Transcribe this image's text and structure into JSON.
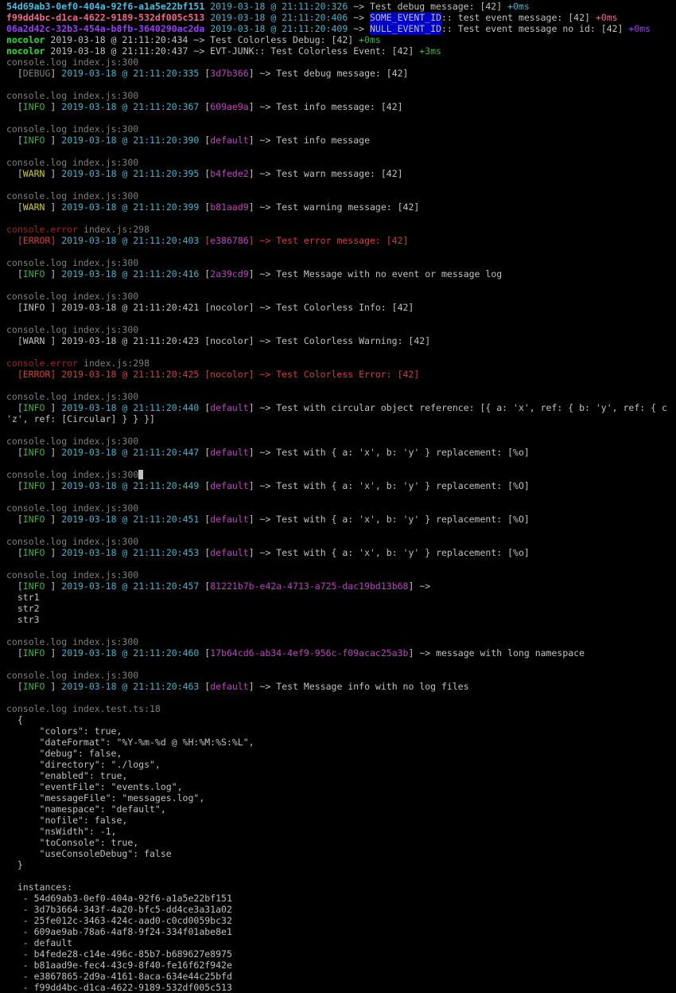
{
  "colors": {
    "default": "#c0c0c0",
    "gray": "#7f7f7f",
    "cyan": "#3ab7cd",
    "cyan_bright": "#3fc1e6",
    "green": "#3fb23f",
    "green_bright": "#22e022",
    "magenta": "#c040c0",
    "pink": "#f06892",
    "red": "#d63c3c",
    "darkred": "#a02222",
    "yellow": "#d2d200",
    "purple": "#9b3df5",
    "blue_bg": "#0000c8"
  },
  "lines": [
    [
      {
        "t": "54d69ab3-0ef0-404a-92f6-a1a5e22bf151",
        "c": "cyan_bright",
        "b": true
      },
      {
        "t": " "
      },
      {
        "t": "2019-03-18 @ 21:11:20:326",
        "c": "cyan"
      },
      {
        "t": " ~> Test debug message: [42] "
      },
      {
        "t": "+0ms",
        "c": "cyan"
      }
    ],
    [
      {
        "t": "f99dd4bc-d1ca-4622-9189-532df005c513",
        "c": "pink",
        "b": true
      },
      {
        "t": " "
      },
      {
        "t": "2019-03-18 @ 21:11:20:406",
        "c": "cyan"
      },
      {
        "t": " ~> "
      },
      {
        "t": "SOME_EVENT_ID",
        "bg": "blue_bg"
      },
      {
        "t": ":: test event message: [42] "
      },
      {
        "t": "+0ms",
        "c": "pink"
      }
    ],
    [
      {
        "t": "06a2d42c-32b3-454a-b8fb-3640290ac2da",
        "c": "purple",
        "b": true
      },
      {
        "t": " "
      },
      {
        "t": "2019-03-18 @ 21:11:20:409",
        "c": "cyan"
      },
      {
        "t": " ~> "
      },
      {
        "t": "NULL_EVENT_ID",
        "bg": "blue_bg"
      },
      {
        "t": ":: Test event message no id: [42] "
      },
      {
        "t": "+0ms",
        "c": "purple"
      }
    ],
    [
      {
        "t": "nocolor",
        "c": "green_bright",
        "b": true
      },
      {
        "t": " 2019-03-18 @ 21:11:20:434 ~> Test Colorless Debug: [42] "
      },
      {
        "t": "+0ms",
        "c": "green"
      }
    ],
    [
      {
        "t": "nocolor",
        "c": "green_bright",
        "b": true
      },
      {
        "t": " 2019-03-18 @ 21:11:20:437 ~> EVT-JUNK:: Test Colorless Event: [42] "
      },
      {
        "t": "+3ms",
        "c": "green"
      }
    ],
    [
      {
        "t": "console.log index.js:300",
        "c": "gray"
      }
    ],
    [
      {
        "t": "  ["
      },
      {
        "t": "DEBUG",
        "c": "gray"
      },
      {
        "t": "] "
      },
      {
        "t": "2019-03-18 @ 21:11:20:335",
        "c": "cyan"
      },
      {
        "t": " ["
      },
      {
        "t": "3d7b366",
        "c": "magenta"
      },
      {
        "t": "] ~> Test debug message: [42]"
      }
    ],
    [],
    [
      {
        "t": "console.log index.js:300",
        "c": "gray"
      }
    ],
    [
      {
        "t": "  ["
      },
      {
        "t": "INFO",
        "c": "green"
      },
      {
        "t": " ] "
      },
      {
        "t": "2019-03-18 @ 21:11:20:367",
        "c": "cyan"
      },
      {
        "t": " ["
      },
      {
        "t": "609ae9a",
        "c": "magenta"
      },
      {
        "t": "] ~> Test info message: [42]"
      }
    ],
    [],
    [
      {
        "t": "console.log index.js:300",
        "c": "gray"
      }
    ],
    [
      {
        "t": "  ["
      },
      {
        "t": "INFO",
        "c": "green"
      },
      {
        "t": " ] "
      },
      {
        "t": "2019-03-18 @ 21:11:20:390",
        "c": "cyan"
      },
      {
        "t": " ["
      },
      {
        "t": "default",
        "c": "magenta"
      },
      {
        "t": "] ~> Test info message"
      }
    ],
    [],
    [
      {
        "t": "console.log index.js:300",
        "c": "gray"
      }
    ],
    [
      {
        "t": "  ["
      },
      {
        "t": "WARN",
        "c": "yellow"
      },
      {
        "t": " ] "
      },
      {
        "t": "2019-03-18 @ 21:11:20:395",
        "c": "cyan"
      },
      {
        "t": " ["
      },
      {
        "t": "b4fede2",
        "c": "magenta"
      },
      {
        "t": "] ~> Test warn message: [42]"
      }
    ],
    [],
    [
      {
        "t": "console.log index.js:300",
        "c": "gray"
      }
    ],
    [
      {
        "t": "  ["
      },
      {
        "t": "WARN",
        "c": "yellow"
      },
      {
        "t": " ] "
      },
      {
        "t": "2019-03-18 @ 21:11:20:399",
        "c": "cyan"
      },
      {
        "t": " ["
      },
      {
        "t": "b81aad9",
        "c": "magenta"
      },
      {
        "t": "] ~> Test warning message: [42]"
      }
    ],
    [],
    [
      {
        "t": "console.error",
        "c": "darkred"
      },
      {
        "t": " index.js:298",
        "c": "gray"
      }
    ],
    [
      {
        "t": "  [ERROR] ",
        "c": "red"
      },
      {
        "t": "2019-03-18 @ 21:11:20:403",
        "c": "cyan"
      },
      {
        "t": " [",
        "c": "red"
      },
      {
        "t": "e386786",
        "c": "magenta"
      },
      {
        "t": "] ~> Test error message: [42]",
        "c": "red"
      }
    ],
    [],
    [
      {
        "t": "console.log index.js:300",
        "c": "gray"
      }
    ],
    [
      {
        "t": "  ["
      },
      {
        "t": "INFO",
        "c": "green"
      },
      {
        "t": " ] "
      },
      {
        "t": "2019-03-18 @ 21:11:20:416",
        "c": "cyan"
      },
      {
        "t": " ["
      },
      {
        "t": "2a39cd9",
        "c": "magenta"
      },
      {
        "t": "] ~> Test Message with no event or message log"
      }
    ],
    [],
    [
      {
        "t": "console.log index.js:300",
        "c": "gray"
      }
    ],
    [
      {
        "t": "  [INFO ] 2019-03-18 @ 21:11:20:421 [nocolor] ~> Test Colorless Info: [42]"
      }
    ],
    [],
    [
      {
        "t": "console.log index.js:300",
        "c": "gray"
      }
    ],
    [
      {
        "t": "  [WARN ] 2019-03-18 @ 21:11:20:423 [nocolor] ~> Test Colorless Warning: [42]"
      }
    ],
    [],
    [
      {
        "t": "console.error",
        "c": "darkred"
      },
      {
        "t": " index.js:298",
        "c": "gray"
      }
    ],
    [
      {
        "t": "  [ERROR] 2019-03-18 @ 21:11:20:425 [nocolor] ~> Test Colorless Error: [42]",
        "c": "red"
      }
    ],
    [],
    [
      {
        "t": "console.log index.js:300",
        "c": "gray"
      }
    ],
    [
      {
        "t": "  ["
      },
      {
        "t": "INFO",
        "c": "green"
      },
      {
        "t": " ] "
      },
      {
        "t": "2019-03-18 @ 21:11:20:440",
        "c": "cyan"
      },
      {
        "t": " ["
      },
      {
        "t": "default",
        "c": "magenta"
      },
      {
        "t": "] ~> Test with circular object reference: [{ a: 'x', ref: { b: 'y', ref: { c"
      }
    ],
    [
      {
        "t": "'z', ref: [Circular] } } }]"
      }
    ],
    [],
    [
      {
        "t": "console.log index.js:300",
        "c": "gray"
      }
    ],
    [
      {
        "t": "  ["
      },
      {
        "t": "INFO",
        "c": "green"
      },
      {
        "t": " ] "
      },
      {
        "t": "2019-03-18 @ 21:11:20:447",
        "c": "cyan"
      },
      {
        "t": " ["
      },
      {
        "t": "default",
        "c": "magenta"
      },
      {
        "t": "] ~> Test with { a: 'x', b: 'y' } replacement: [%o]"
      }
    ],
    [],
    [
      {
        "t": "console.log index.js:300",
        "c": "gray"
      },
      {
        "cursor": true
      }
    ],
    [
      {
        "t": "  ["
      },
      {
        "t": "INFO",
        "c": "green"
      },
      {
        "t": " ] "
      },
      {
        "t": "2019-03-18 @ 21:11:20:449",
        "c": "cyan"
      },
      {
        "t": " ["
      },
      {
        "t": "default",
        "c": "magenta"
      },
      {
        "t": "] ~> Test with { a: 'x', b: 'y' } replacement: [%O]"
      }
    ],
    [],
    [
      {
        "t": "console.log index.js:300",
        "c": "gray"
      }
    ],
    [
      {
        "t": "  ["
      },
      {
        "t": "INFO",
        "c": "green"
      },
      {
        "t": " ] "
      },
      {
        "t": "2019-03-18 @ 21:11:20:451",
        "c": "cyan"
      },
      {
        "t": " ["
      },
      {
        "t": "default",
        "c": "magenta"
      },
      {
        "t": "] ~> Test with { a: 'x', b: 'y' } replacement: [%O]"
      }
    ],
    [],
    [
      {
        "t": "console.log index.js:300",
        "c": "gray"
      }
    ],
    [
      {
        "t": "  ["
      },
      {
        "t": "INFO",
        "c": "green"
      },
      {
        "t": " ] "
      },
      {
        "t": "2019-03-18 @ 21:11:20:453",
        "c": "cyan"
      },
      {
        "t": " ["
      },
      {
        "t": "default",
        "c": "magenta"
      },
      {
        "t": "] ~> Test with { a: 'x', b: 'y' } replacement: [%o]"
      }
    ],
    [],
    [
      {
        "t": "console.log index.js:300",
        "c": "gray"
      }
    ],
    [
      {
        "t": "  ["
      },
      {
        "t": "INFO",
        "c": "green"
      },
      {
        "t": " ] "
      },
      {
        "t": "2019-03-18 @ 21:11:20:457",
        "c": "cyan"
      },
      {
        "t": " ["
      },
      {
        "t": "81221b7b-e42a-4713-a725-dac19bd13b68",
        "c": "magenta"
      },
      {
        "t": "] ~>"
      }
    ],
    [
      {
        "t": "  str1"
      }
    ],
    [
      {
        "t": "  str2"
      }
    ],
    [
      {
        "t": "  str3"
      }
    ],
    [],
    [
      {
        "t": "console.log index.js:300",
        "c": "gray"
      }
    ],
    [
      {
        "t": "  ["
      },
      {
        "t": "INFO",
        "c": "green"
      },
      {
        "t": " ] "
      },
      {
        "t": "2019-03-18 @ 21:11:20:460",
        "c": "cyan"
      },
      {
        "t": " ["
      },
      {
        "t": "17b64cd6-ab34-4ef9-956c-f09acac25a3b",
        "c": "magenta"
      },
      {
        "t": "] ~> message with long namespace"
      }
    ],
    [],
    [
      {
        "t": "console.log index.js:300",
        "c": "gray"
      }
    ],
    [
      {
        "t": "  ["
      },
      {
        "t": "INFO",
        "c": "green"
      },
      {
        "t": " ] "
      },
      {
        "t": "2019-03-18 @ 21:11:20:463",
        "c": "cyan"
      },
      {
        "t": " ["
      },
      {
        "t": "default",
        "c": "magenta"
      },
      {
        "t": "] ~> Test Message info with no log files"
      }
    ],
    [],
    [
      {
        "t": "console.log index.test.ts:18",
        "c": "gray"
      }
    ],
    [
      {
        "t": "  {"
      }
    ],
    [
      {
        "t": "      \"colors\": true,"
      }
    ],
    [
      {
        "t": "      \"dateFormat\": \"%Y-%m-%d @ %H:%M:%S:%L\","
      }
    ],
    [
      {
        "t": "      \"debug\": false,"
      }
    ],
    [
      {
        "t": "      \"directory\": \"./logs\","
      }
    ],
    [
      {
        "t": "      \"enabled\": true,"
      }
    ],
    [
      {
        "t": "      \"eventFile\": \"events.log\","
      }
    ],
    [
      {
        "t": "      \"messageFile\": \"messages.log\","
      }
    ],
    [
      {
        "t": "      \"namespace\": \"default\","
      }
    ],
    [
      {
        "t": "      \"nofile\": false,"
      }
    ],
    [
      {
        "t": "      \"nsWidth\": -1,"
      }
    ],
    [
      {
        "t": "      \"toConsole\": true,"
      }
    ],
    [
      {
        "t": "      \"useConsoleDebug\": false"
      }
    ],
    [
      {
        "t": "  }"
      }
    ],
    [],
    [
      {
        "t": "  instances:"
      }
    ],
    [
      {
        "t": "   - 54d69ab3-0ef0-404a-92f6-a1a5e22bf151"
      }
    ],
    [
      {
        "t": "   - 3d7b3664-343f-4a20-bfc5-dd4ce3a31a02"
      }
    ],
    [
      {
        "t": "   - 25fe012c-3463-424c-aad0-c0cd0059bc32"
      }
    ],
    [
      {
        "t": "   - 609ae9ab-78a6-4af8-9f24-334f01abe8e1"
      }
    ],
    [
      {
        "t": "   - default"
      }
    ],
    [
      {
        "t": "   - b4fede28-c14e-496c-85b7-b689627e8975"
      }
    ],
    [
      {
        "t": "   - b81aad9e-fec4-43c9-8f40-fe16f62f942e"
      }
    ],
    [
      {
        "t": "   - e3867865-2d9a-4161-8aca-634e44c25bfd"
      }
    ],
    [
      {
        "t": "   - f99dd4bc-d1ca-4622-9189-532df005c513"
      }
    ]
  ]
}
